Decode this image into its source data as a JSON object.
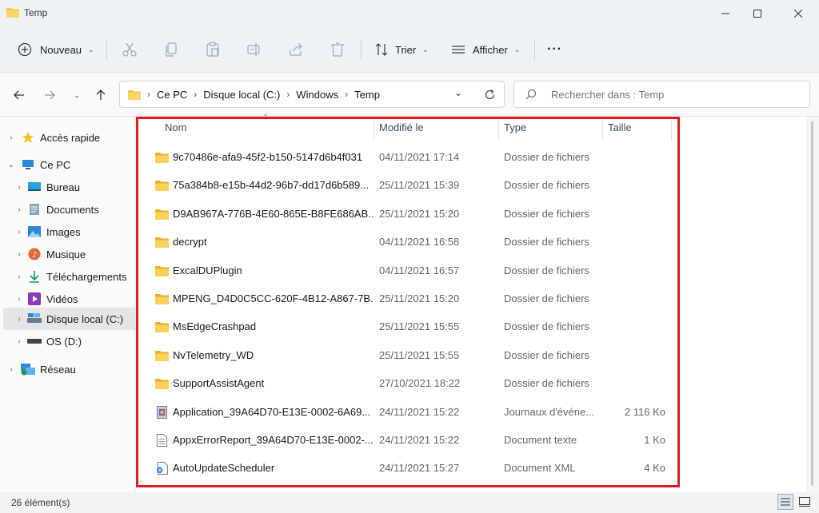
{
  "window": {
    "title": "Temp"
  },
  "toolbar": {
    "new_label": "Nouveau",
    "sort_label": "Trier",
    "view_label": "Afficher",
    "more_label": "···"
  },
  "address": {
    "crumbs": [
      "Ce PC",
      "Disque local (C:)",
      "Windows",
      "Temp"
    ]
  },
  "search": {
    "placeholder": "Rechercher dans : Temp"
  },
  "sidebar": {
    "items": [
      {
        "label": "Accès rapide",
        "icon": "star-icon"
      },
      {
        "label": "Ce PC",
        "icon": "pc-icon"
      },
      {
        "label": "Bureau",
        "icon": "desktop-icon"
      },
      {
        "label": "Documents",
        "icon": "documents-icon"
      },
      {
        "label": "Images",
        "icon": "images-icon"
      },
      {
        "label": "Musique",
        "icon": "music-icon"
      },
      {
        "label": "Téléchargements",
        "icon": "download-icon"
      },
      {
        "label": "Vidéos",
        "icon": "video-icon"
      },
      {
        "label": "Disque local (C:)",
        "icon": "drive-icon"
      },
      {
        "label": "OS (D:)",
        "icon": "drive-icon"
      },
      {
        "label": "Réseau",
        "icon": "network-icon"
      }
    ]
  },
  "columns": {
    "name": "Nom",
    "modified": "Modifié le",
    "type": "Type",
    "size": "Taille"
  },
  "files": [
    {
      "name": "9c70486e-afa9-45f2-b150-5147d6b4f031",
      "date": "04/11/2021 17:14",
      "type": "Dossier de fichiers",
      "size": "",
      "icon": "folder"
    },
    {
      "name": "75a384b8-e15b-44d2-96b7-dd17d6b589...",
      "date": "25/11/2021 15:39",
      "type": "Dossier de fichiers",
      "size": "",
      "icon": "folder"
    },
    {
      "name": "D9AB967A-776B-4E60-865E-B8FE686AB...",
      "date": "25/11/2021 15:20",
      "type": "Dossier de fichiers",
      "size": "",
      "icon": "folder"
    },
    {
      "name": "decrypt",
      "date": "04/11/2021 16:58",
      "type": "Dossier de fichiers",
      "size": "",
      "icon": "folder"
    },
    {
      "name": "ExcalDUPlugin",
      "date": "04/11/2021 16:57",
      "type": "Dossier de fichiers",
      "size": "",
      "icon": "folder"
    },
    {
      "name": "MPENG_D4D0C5CC-620F-4B12-A867-7B...",
      "date": "25/11/2021 15:20",
      "type": "Dossier de fichiers",
      "size": "",
      "icon": "folder"
    },
    {
      "name": "MsEdgeCrashpad",
      "date": "25/11/2021 15:55",
      "type": "Dossier de fichiers",
      "size": "",
      "icon": "folder"
    },
    {
      "name": "NvTelemetry_WD",
      "date": "25/11/2021 15:55",
      "type": "Dossier de fichiers",
      "size": "",
      "icon": "folder"
    },
    {
      "name": "SupportAssistAgent",
      "date": "27/10/2021 18:22",
      "type": "Dossier de fichiers",
      "size": "",
      "icon": "folder"
    },
    {
      "name": "Application_39A64D70-E13E-0002-6A69...",
      "date": "24/11/2021 15:22",
      "type": "Journaux d'événe...",
      "size": "2 116 Ko",
      "icon": "eventlog"
    },
    {
      "name": "AppxErrorReport_39A64D70-E13E-0002-...",
      "date": "24/11/2021 15:22",
      "type": "Document texte",
      "size": "1 Ko",
      "icon": "text"
    },
    {
      "name": "AutoUpdateScheduler",
      "date": "24/11/2021 15:27",
      "type": "Document XML",
      "size": "4 Ko",
      "icon": "xml"
    }
  ],
  "status": {
    "count": "26 élément(s)"
  },
  "colors": {
    "accent": "#0067c0",
    "folder": "#f8c840",
    "highlight": "#e11b22"
  }
}
